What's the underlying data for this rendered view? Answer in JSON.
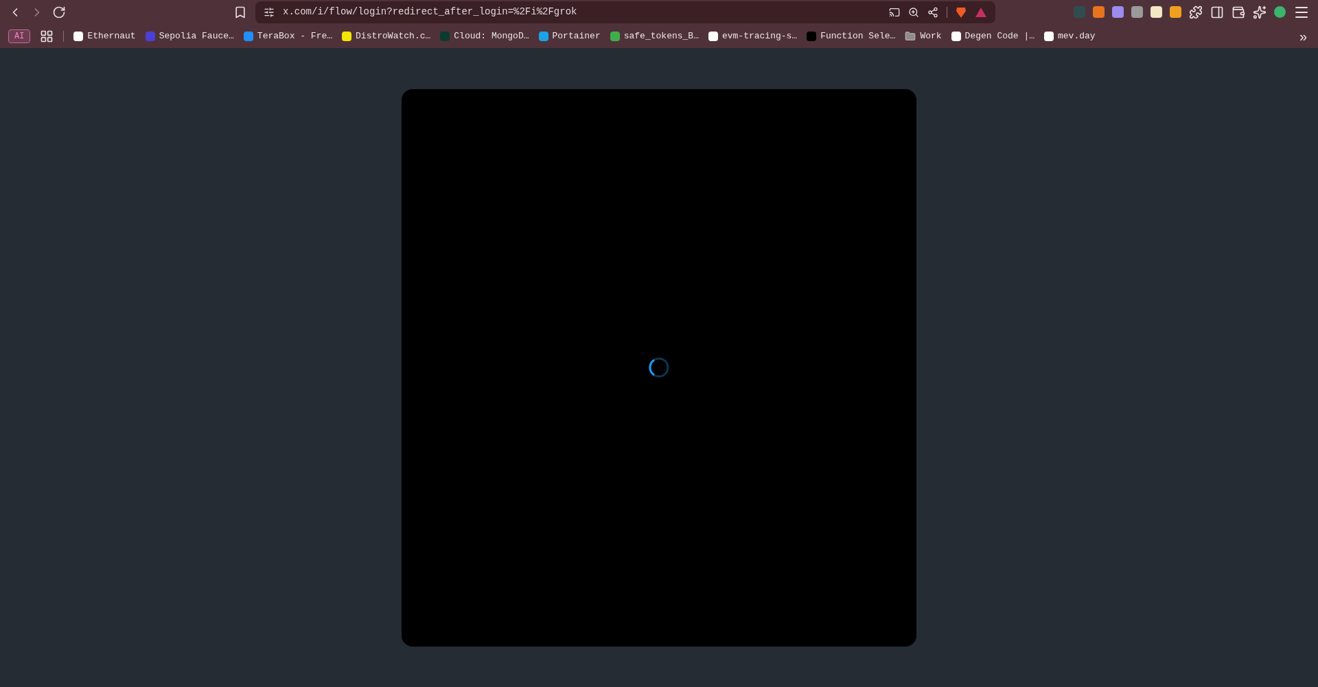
{
  "address_bar": {
    "url": "x.com/i/flow/login?redirect_after_login=%2Fi%2Fgrok"
  },
  "bookmarks_bar": {
    "ai_button": "AI",
    "items": [
      {
        "label": "Ethernaut",
        "kind": "link"
      },
      {
        "label": "Sepolia Fauce…",
        "kind": "link"
      },
      {
        "label": "TeraBox - Fre…",
        "kind": "link"
      },
      {
        "label": "DistroWatch.c…",
        "kind": "link"
      },
      {
        "label": "Cloud: MongoD…",
        "kind": "link"
      },
      {
        "label": "Portainer",
        "kind": "link"
      },
      {
        "label": "safe_tokens_B…",
        "kind": "link"
      },
      {
        "label": "evm-tracing-s…",
        "kind": "link"
      },
      {
        "label": "Function Sele…",
        "kind": "link"
      },
      {
        "label": "Work",
        "kind": "folder"
      },
      {
        "label": "Degen Code |…",
        "kind": "link"
      },
      {
        "label": "mev.day",
        "kind": "link"
      }
    ],
    "overflow": "»"
  },
  "login_dialog": {
    "loading": true
  }
}
